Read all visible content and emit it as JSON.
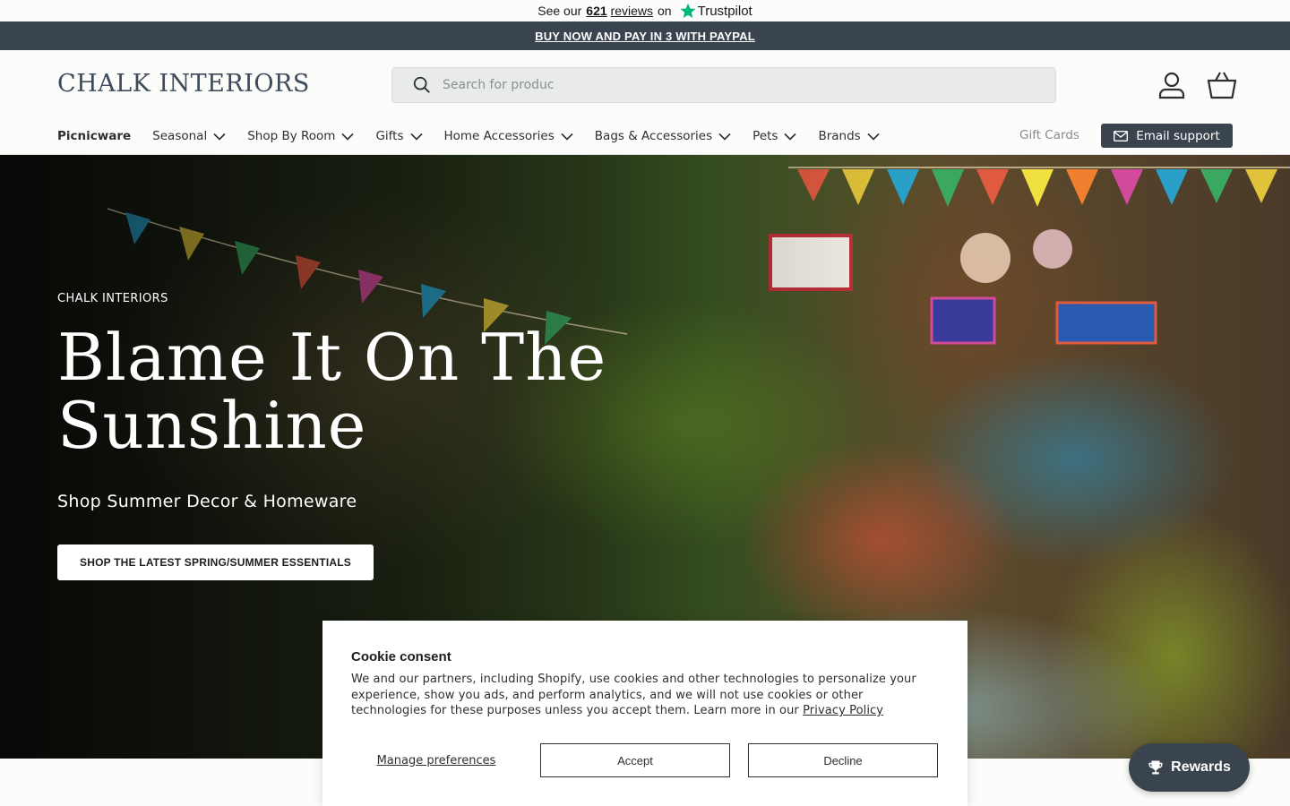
{
  "trustbar": {
    "prefix": "See our",
    "count": "621",
    "reviews_text": "reviews",
    "suffix": "on",
    "brand": "Trustpilot"
  },
  "promo": {
    "text": "BUY NOW AND PAY IN 3 WITH PAYPAL"
  },
  "header": {
    "logo": "CHALK INTERIORS",
    "search_placeholder": "Search for produc",
    "account_icon": "user-icon",
    "cart_icon": "basket-icon"
  },
  "nav": {
    "items": [
      {
        "label": "Picnicware",
        "dropdown": false
      },
      {
        "label": "Seasonal",
        "dropdown": true
      },
      {
        "label": "Shop By Room",
        "dropdown": true
      },
      {
        "label": "Gifts",
        "dropdown": true
      },
      {
        "label": "Home Accessories",
        "dropdown": true
      },
      {
        "label": "Bags & Accessories",
        "dropdown": true
      },
      {
        "label": "Pets",
        "dropdown": true
      },
      {
        "label": "Brands",
        "dropdown": true
      }
    ],
    "gift_cards": "Gift Cards",
    "email_support": "Email support"
  },
  "hero": {
    "kicker": "CHALK INTERIORS",
    "title": "Blame It On The Sunshine",
    "subtitle": "Shop Summer Decor & Homeware",
    "cta": "SHOP THE LATEST SPRING/SUMMER ESSENTIALS"
  },
  "cookie": {
    "title": "Cookie consent",
    "body": "We and our partners, including Shopify, use cookies and other technologies to personalize your experience, show you ads, and perform analytics, and we will not use cookies or other technologies for these purposes unless you accept them. Learn more in our",
    "policy_link": "Privacy Policy",
    "manage": "Manage preferences",
    "accept": "Accept",
    "decline": "Decline"
  },
  "rewards": {
    "label": "Rewards"
  },
  "colors": {
    "brand_dark": "#3a444f",
    "logo": "#3d4a5b",
    "trustpilot_green": "#00b67a"
  }
}
